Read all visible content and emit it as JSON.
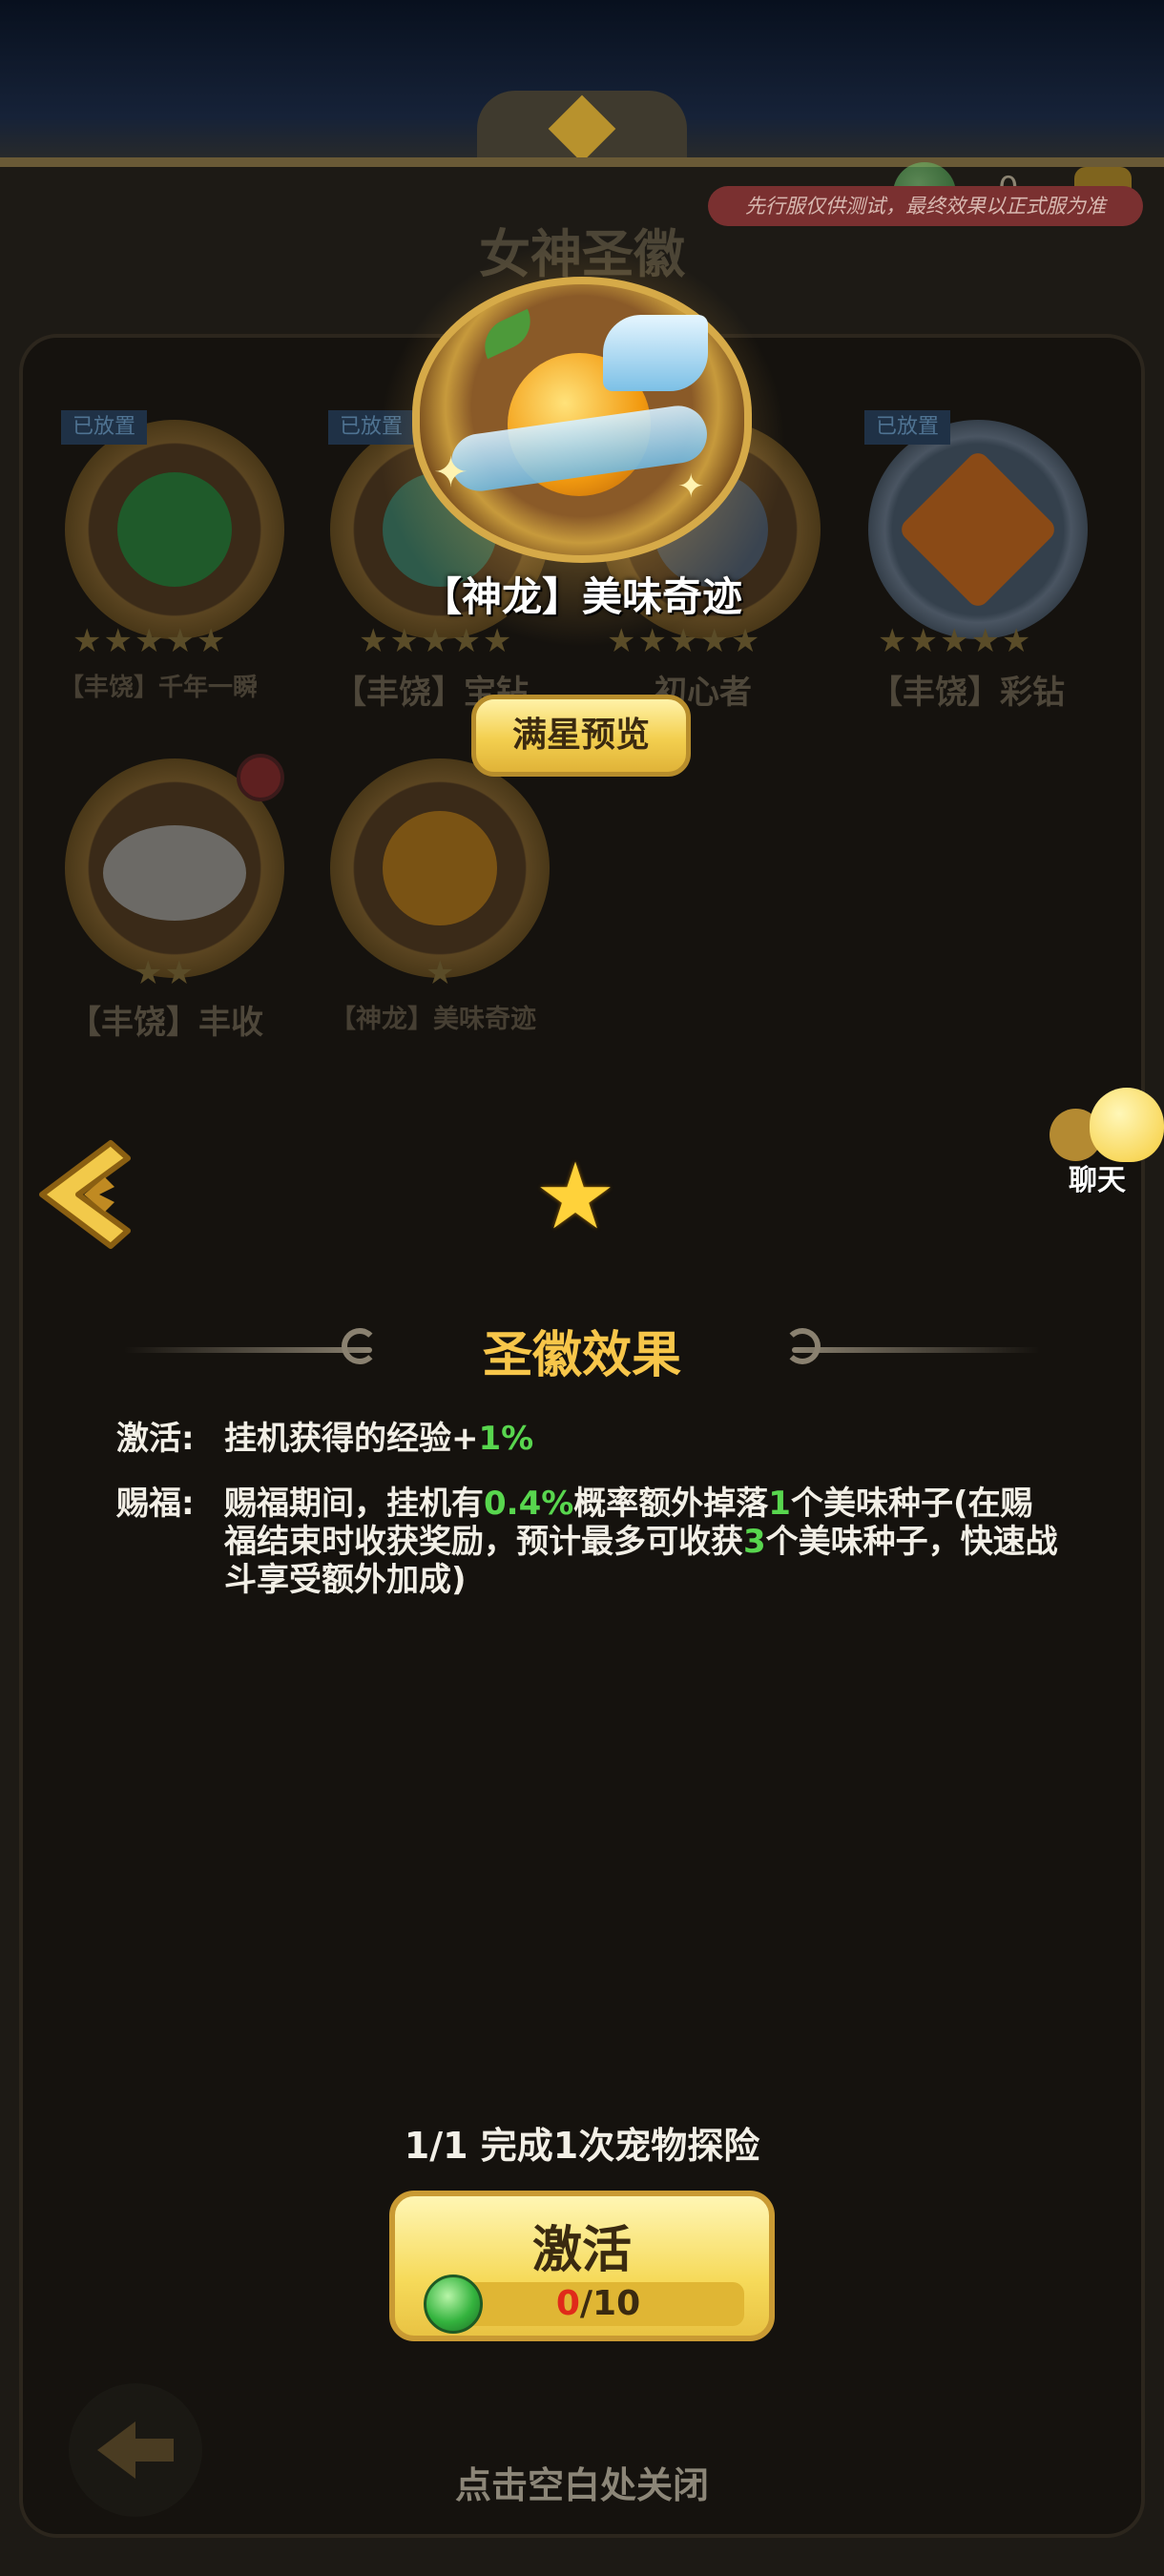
{
  "header": {
    "bg_title": "女神圣徽",
    "test_notice": "先行服仅供测试，最终效果以正式服为准",
    "currency_count": "0"
  },
  "badges": [
    {
      "name": "【丰饶】千年一瞬",
      "placed": "已放置",
      "stars": "★★★★★"
    },
    {
      "name": "【丰饶】宝钻",
      "placed": "已放置",
      "stars": "★★★★★"
    },
    {
      "name": "初心者",
      "placed": "",
      "stars": "★★★★★"
    },
    {
      "name": "【丰饶】彩钻",
      "placed": "已放置",
      "stars": "★★★★★"
    },
    {
      "name": "【丰饶】丰收",
      "placed": "",
      "stars": "★★"
    },
    {
      "name": "【神龙】美味奇迹",
      "placed": "",
      "stars": "★"
    }
  ],
  "popup": {
    "badge_name": "【神龙】美味奇迹",
    "preview_button": "满星预览",
    "chat_label": "聊天",
    "star_icon": "★",
    "section_title": "圣徽效果",
    "effects": {
      "activate_label": "激活:",
      "activate_text_1": "挂机获得的经验+",
      "activate_value": "1%",
      "bless_label": "赐福:",
      "bless_text_1": "赐福期间，挂机有",
      "bless_value_1": "0.4%",
      "bless_text_2": "概率额外掉落",
      "bless_value_2": "1",
      "bless_text_3": "个美味种子(在赐福结束时收获奖励，预计最多可收获",
      "bless_value_3": "3",
      "bless_text_4": "个美味种子，快速战斗享受额外加成)"
    },
    "task_text": "1/1  完成1次宠物探险",
    "activate_button": "激活",
    "cost_owned": "0",
    "cost_required": "/10",
    "close_hint": "点击空白处关闭"
  },
  "colors": {
    "accent_gold": "#f7c64a",
    "highlight_green": "#58d64e",
    "cost_red": "#e02a1a"
  }
}
